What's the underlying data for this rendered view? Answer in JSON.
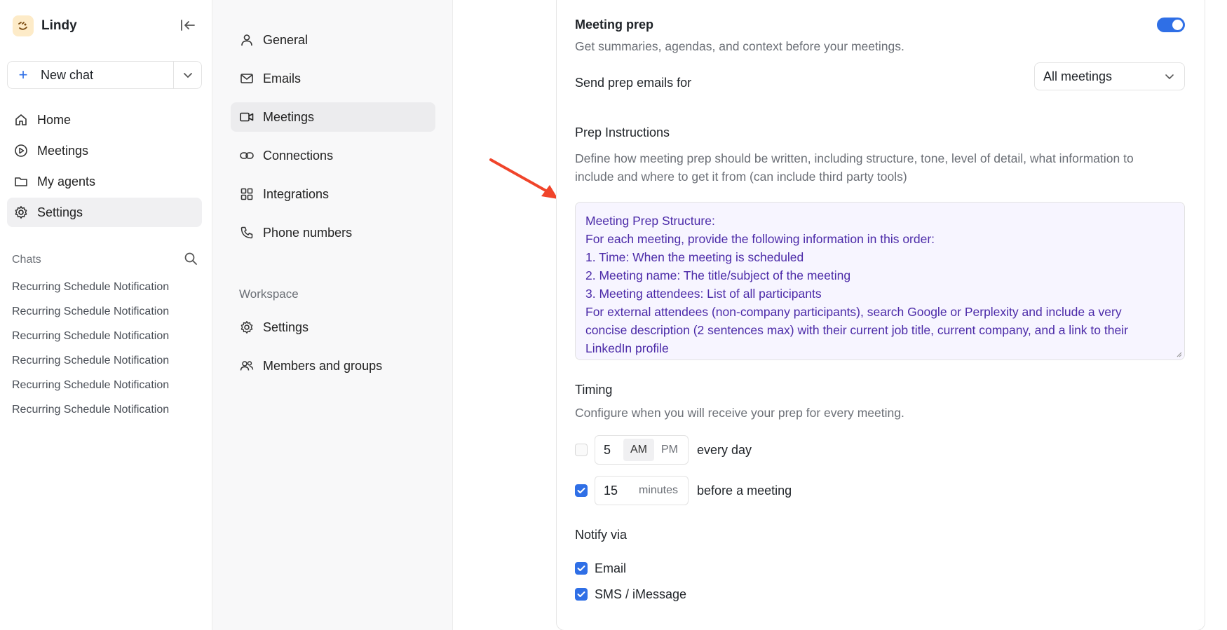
{
  "app": {
    "name": "Lindy",
    "accent": "#2f6fe6",
    "new_chat_label": "New chat",
    "nav": [
      {
        "label": "Home",
        "icon": "home-icon",
        "active": false
      },
      {
        "label": "Meetings",
        "icon": "play-circle-icon",
        "active": false
      },
      {
        "label": "My agents",
        "icon": "folder-icon",
        "active": false
      },
      {
        "label": "Settings",
        "icon": "gear-icon",
        "active": true
      }
    ],
    "chats_label": "Chats",
    "chats": [
      "Recurring Schedule Notification",
      "Recurring Schedule Notification",
      "Recurring Schedule Notification",
      "Recurring Schedule Notification",
      "Recurring Schedule Notification",
      "Recurring Schedule Notification"
    ]
  },
  "settings_nav": {
    "personal": [
      {
        "label": "General",
        "icon": "user-icon",
        "active": false
      },
      {
        "label": "Emails",
        "icon": "mail-icon",
        "active": false
      },
      {
        "label": "Meetings",
        "icon": "video-icon",
        "active": true
      },
      {
        "label": "Connections",
        "icon": "link-icon",
        "active": false
      },
      {
        "label": "Integrations",
        "icon": "grid-icon",
        "active": false
      },
      {
        "label": "Phone numbers",
        "icon": "phone-icon",
        "active": false
      }
    ],
    "workspace_label": "Workspace",
    "workspace": [
      {
        "label": "Settings",
        "icon": "gear-icon",
        "active": false
      },
      {
        "label": "Members and groups",
        "icon": "users-icon",
        "active": false
      }
    ]
  },
  "meeting_prep": {
    "title": "Meeting prep",
    "description": "Get summaries, agendas, and context before your meetings.",
    "enabled": true,
    "send_for_label": "Send prep emails for",
    "send_for_value": "All meetings",
    "instructions_title": "Prep Instructions",
    "instructions_description_1": "Define how meeting prep should be written, including structure, tone, level of detail, what information to",
    "instructions_description_2": "include and where to get it from (can include third party tools)",
    "instructions_lines": [
      "Meeting Prep Structure:",
      "For each meeting, provide the following information in this order:",
      "1. Time: When the meeting is scheduled",
      "2. Meeting name: The title/subject of the meeting",
      "3. Meeting attendees: List of all participants",
      "For external attendees (non-company participants), search Google or Perplexity and include a very",
      "concise description (2 sentences max) with their current job title, current company, and a link to their",
      "LinkedIn profile"
    ],
    "timing_title": "Timing",
    "timing_description": "Configure when you will receive your prep for every meeting.",
    "daily": {
      "checked": false,
      "hour": "5",
      "am": "AM",
      "pm": "PM",
      "suffix": "every day"
    },
    "before": {
      "checked": true,
      "value": "15",
      "unit": "minutes",
      "suffix": "before a meeting"
    },
    "notify_title": "Notify via",
    "notify_email": {
      "label": "Email",
      "checked": true
    },
    "notify_sms": {
      "label": "SMS / iMessage",
      "checked": true
    }
  }
}
